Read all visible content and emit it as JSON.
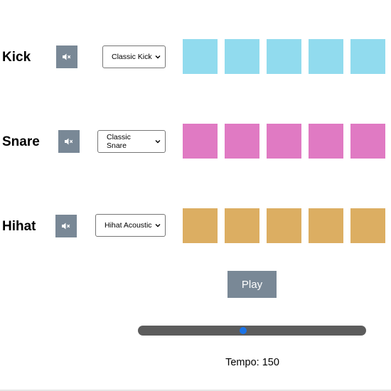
{
  "tracks": [
    {
      "name": "Kick",
      "sound": "Classic Kick",
      "pad_color": "#91dbee",
      "pads": 5
    },
    {
      "name": "Snare",
      "sound": "Classic Snare",
      "pad_color": "#e07ac3",
      "pads": 5
    },
    {
      "name": "Hihat",
      "sound": "Hihat Acoustic",
      "pad_color": "#dcae62",
      "pads": 5
    }
  ],
  "icons": {
    "mute": "speaker-muted-icon",
    "dropdown": "chevron-down-icon"
  },
  "play_label": "Play",
  "tempo": {
    "label": "Tempo: 150",
    "value": 150,
    "slider_fraction": 0.46
  },
  "colors": {
    "button_bg": "#798896",
    "slider_track": "#5c5c5c",
    "slider_thumb": "#1a73e8"
  }
}
